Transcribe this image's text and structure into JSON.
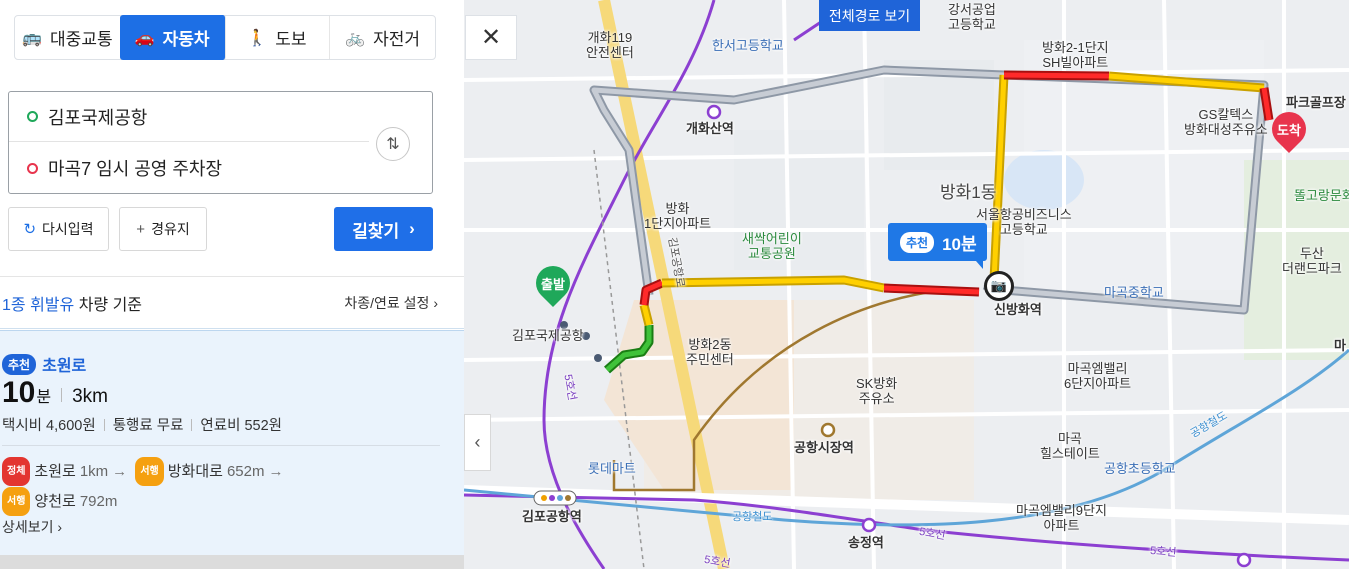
{
  "modes": [
    {
      "icon": "bus-icon",
      "label": "대중교통"
    },
    {
      "icon": "car-icon",
      "label": "자동차"
    },
    {
      "icon": "walk-icon",
      "label": "도보"
    },
    {
      "icon": "bicycle-icon",
      "label": "자전거"
    }
  ],
  "active_mode": "자동차",
  "close_label": "✕",
  "origin": "김포국제공항",
  "destination": "마곡7 임시 공영 주차장",
  "buttons": {
    "reset": "다시입력",
    "waypoint": "경유지",
    "search": "길찾기"
  },
  "vehicle": {
    "highlight": "1종 휘발유",
    "suffix": "차량 기준",
    "settings": "차종/연료 설정"
  },
  "result": {
    "tag": "추천",
    "road": "초원로",
    "minutes": "10",
    "minutes_unit": "분",
    "distance": "3km",
    "taxi": "택시비 4,600원",
    "toll": "통행료 무료",
    "fuel": "연료비 552원",
    "segments": [
      {
        "badge": "정체",
        "color": "red",
        "name": "초원로",
        "length": "1km"
      },
      {
        "badge": "서행",
        "color": "orange",
        "name": "방화대로",
        "length": "652m"
      },
      {
        "badge": "서행",
        "color": "orange",
        "name": "양천로",
        "length": "792m"
      }
    ],
    "detail": "상세보기"
  },
  "map": {
    "full_route_button": "전체경로 보기",
    "bubble_tag": "추천",
    "bubble_time": "10분",
    "start_pin": "출발",
    "end_pin": "도착",
    "labels": {
      "gaehwa119": "개화119\n안전센터",
      "hanseo": "한서고등학교",
      "gangseo": "강서공업\n고등학교",
      "banghwa21": "방화2-1단지\nSH빌아파트",
      "gaehwasan": "개화산역",
      "gs": "GS칼텍스\n방화대성주유소",
      "parkgolf": "파크골프장",
      "banghwa1": "방화\n1단지아파트",
      "saessak": "새싹어린이\n교통공원",
      "banghwa1dong": "방화1동",
      "seoulbiz": "서울항공비즈니스\n고등학교",
      "ddolgo": "똘고랑문화",
      "dusan": "두산\n더랜드파크",
      "gimpoairport": "김포국제공항",
      "banghwa2dong": "방화2동\n주민센터",
      "singbanghwa": "신방화역",
      "magokmiddle": "마곡중학교",
      "ma": "마",
      "sk": "SK방화\n주유소",
      "magokvalley6": "마곡엠밸리\n6단지아파트",
      "lotte": "롯데마트",
      "airportmarket": "공항시장역",
      "magokhills": "마곡\n힐스테이트",
      "airportelem": "공항초등학교",
      "gimpoairportstation": "김포공항역",
      "magokvalley9": "마곡엠밸리9단지\n아파트",
      "songjeong": "송정역",
      "line5a": "5호선",
      "line5b": "5호선",
      "line5c": "5호선",
      "airportrail": "공항철도",
      "airportrail2": "공항철도",
      "gimpodaero": "김포공항로",
      "line5d": "5호선"
    }
  }
}
